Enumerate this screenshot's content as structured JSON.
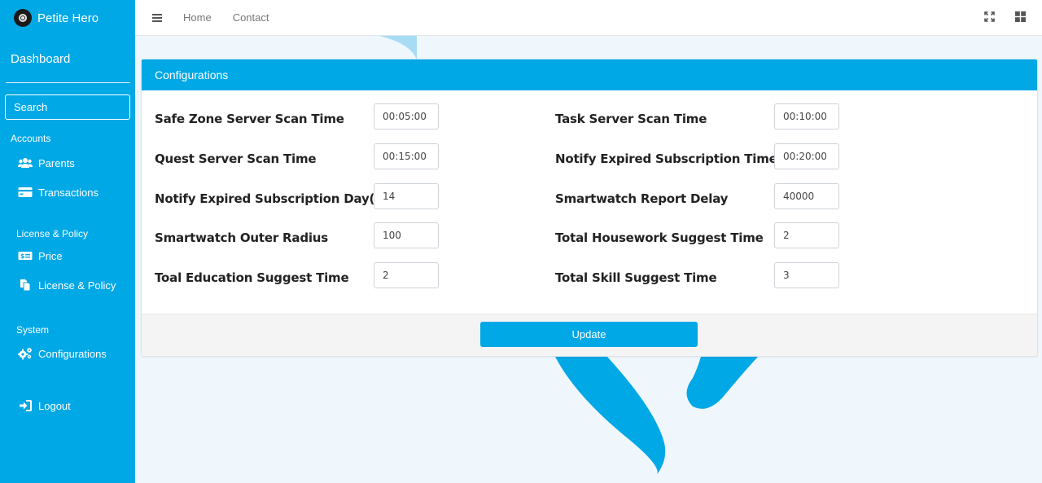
{
  "brand": {
    "name": "Petite Hero"
  },
  "sidebar": {
    "dashboard": "Dashboard",
    "search_placeholder": "Search",
    "sections": [
      {
        "label": "Accounts",
        "items": [
          {
            "label": "Parents",
            "icon": "users-icon"
          },
          {
            "label": "Transactions",
            "icon": "credit-card-icon"
          }
        ]
      },
      {
        "label": "License & Policy",
        "items": [
          {
            "label": "Price",
            "icon": "money-icon"
          },
          {
            "label": "License & Policy",
            "icon": "copy-icon"
          }
        ]
      },
      {
        "label": "System",
        "items": [
          {
            "label": "Configurations",
            "icon": "cogs-icon"
          }
        ]
      }
    ],
    "logout": "Logout"
  },
  "topbar": {
    "links": [
      "Home",
      "Contact"
    ],
    "right_icons": [
      "expand-icon",
      "grid-icon"
    ]
  },
  "card": {
    "title": "Configurations",
    "fields": [
      {
        "label": "Safe Zone Server Scan Time",
        "value": "00:05:00"
      },
      {
        "label": "Task Server Scan Time",
        "value": "00:10:00"
      },
      {
        "label": "Quest Server Scan Time",
        "value": "00:15:00"
      },
      {
        "label": "Notify Expired Subscription Time",
        "value": "00:20:00"
      },
      {
        "label": "Notify Expired Subscription Day(s)",
        "value": "14"
      },
      {
        "label": "Smartwatch Report Delay",
        "value": "40000"
      },
      {
        "label": "Smartwatch Outer Radius",
        "value": "100"
      },
      {
        "label": "Total Housework Suggest Time",
        "value": "2"
      },
      {
        "label": "Toal Education Suggest Time",
        "value": "2"
      },
      {
        "label": "Total Skill Suggest Time",
        "value": "3"
      }
    ],
    "submit_label": "Update"
  },
  "colors": {
    "primary": "#00a8e6",
    "background": "#f0f7fc"
  }
}
